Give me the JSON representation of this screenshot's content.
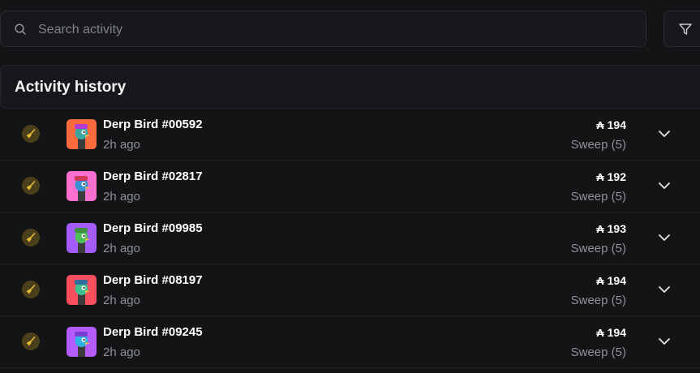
{
  "search": {
    "placeholder": "Search activity",
    "value": ""
  },
  "panel": {
    "title": "Activity history"
  },
  "icons": {
    "currency": "ASTAR",
    "sweep": "broom-icon",
    "expand": "chevron-down-icon"
  },
  "colors": {
    "badge": "#4a3f1a",
    "broom": "#e0b83a"
  },
  "rows": [
    {
      "name": "Derp Bird #00592",
      "time": "2h ago",
      "price": "194",
      "type": "Sweep (5)",
      "thumb_bg": "#ff6a3d",
      "bird": "#3aa6a0",
      "hat": "#b33bd1"
    },
    {
      "name": "Derp Bird #02817",
      "time": "2h ago",
      "price": "192",
      "type": "Sweep (5)",
      "thumb_bg": "#ff6fd0",
      "bird": "#3a8fd1",
      "hat": "#d13a5a"
    },
    {
      "name": "Derp Bird #09985",
      "time": "2h ago",
      "price": "193",
      "type": "Sweep (5)",
      "thumb_bg": "#a45cff",
      "bird": "#4fbf5a",
      "hat": "#3f8f3f"
    },
    {
      "name": "Derp Bird #08197",
      "time": "2h ago",
      "price": "194",
      "type": "Sweep (5)",
      "thumb_bg": "#ff4f5e",
      "bird": "#3fbf8f",
      "hat": "#2f6f9f"
    },
    {
      "name": "Derp Bird #09245",
      "time": "2h ago",
      "price": "194",
      "type": "Sweep (5)",
      "thumb_bg": "#b45cff",
      "bird": "#2fb0e0",
      "hat": "#7a3fd0"
    }
  ]
}
